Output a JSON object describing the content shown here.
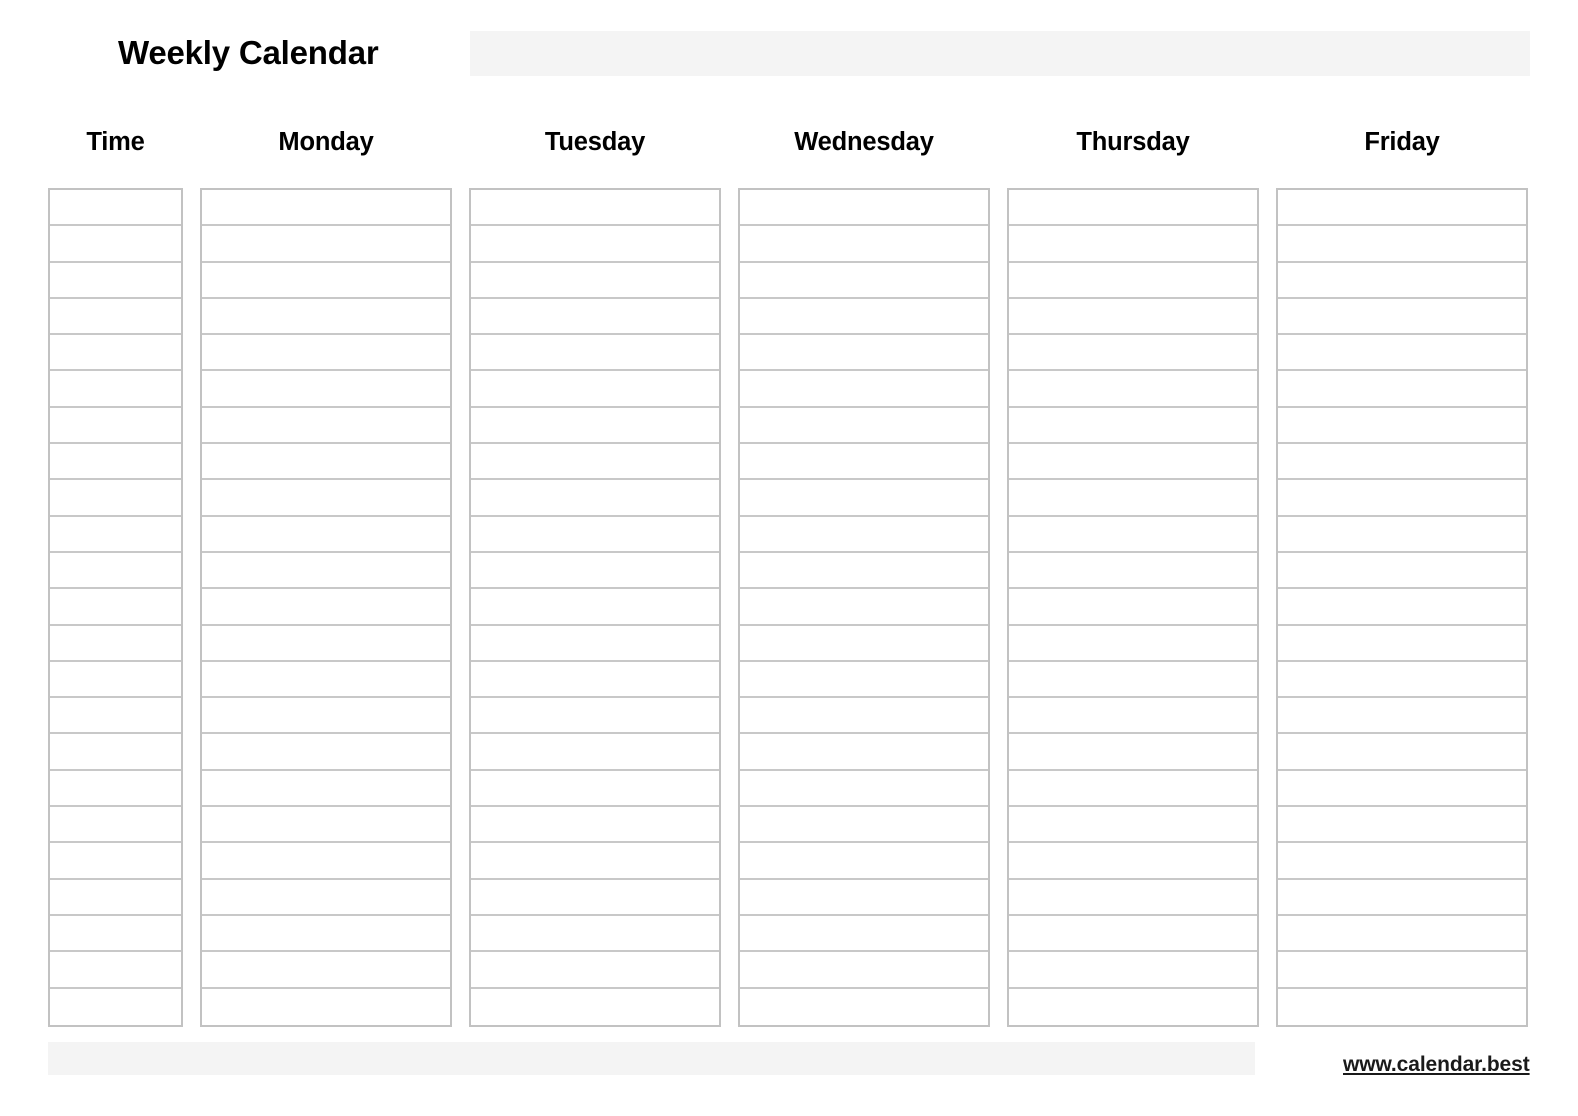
{
  "header": {
    "title": "Weekly Calendar",
    "bar_color": "#f4f4f4"
  },
  "table": {
    "columns": [
      {
        "key": "time",
        "label": "Time",
        "type": "time"
      },
      {
        "key": "monday",
        "label": "Monday",
        "type": "day"
      },
      {
        "key": "tuesday",
        "label": "Tuesday",
        "type": "day"
      },
      {
        "key": "wednesday",
        "label": "Wednesday",
        "type": "day"
      },
      {
        "key": "thursday",
        "label": "Thursday",
        "type": "day"
      },
      {
        "key": "friday",
        "label": "Friday",
        "type": "day"
      }
    ],
    "row_count": 23,
    "rows": [
      {
        "time": "",
        "monday": "",
        "tuesday": "",
        "wednesday": "",
        "thursday": "",
        "friday": ""
      },
      {
        "time": "",
        "monday": "",
        "tuesday": "",
        "wednesday": "",
        "thursday": "",
        "friday": ""
      },
      {
        "time": "",
        "monday": "",
        "tuesday": "",
        "wednesday": "",
        "thursday": "",
        "friday": ""
      },
      {
        "time": "",
        "monday": "",
        "tuesday": "",
        "wednesday": "",
        "thursday": "",
        "friday": ""
      },
      {
        "time": "",
        "monday": "",
        "tuesday": "",
        "wednesday": "",
        "thursday": "",
        "friday": ""
      },
      {
        "time": "",
        "monday": "",
        "tuesday": "",
        "wednesday": "",
        "thursday": "",
        "friday": ""
      },
      {
        "time": "",
        "monday": "",
        "tuesday": "",
        "wednesday": "",
        "thursday": "",
        "friday": ""
      },
      {
        "time": "",
        "monday": "",
        "tuesday": "",
        "wednesday": "",
        "thursday": "",
        "friday": ""
      },
      {
        "time": "",
        "monday": "",
        "tuesday": "",
        "wednesday": "",
        "thursday": "",
        "friday": ""
      },
      {
        "time": "",
        "monday": "",
        "tuesday": "",
        "wednesday": "",
        "thursday": "",
        "friday": ""
      },
      {
        "time": "",
        "monday": "",
        "tuesday": "",
        "wednesday": "",
        "thursday": "",
        "friday": ""
      },
      {
        "time": "",
        "monday": "",
        "tuesday": "",
        "wednesday": "",
        "thursday": "",
        "friday": ""
      },
      {
        "time": "",
        "monday": "",
        "tuesday": "",
        "wednesday": "",
        "thursday": "",
        "friday": ""
      },
      {
        "time": "",
        "monday": "",
        "tuesday": "",
        "wednesday": "",
        "thursday": "",
        "friday": ""
      },
      {
        "time": "",
        "monday": "",
        "tuesday": "",
        "wednesday": "",
        "thursday": "",
        "friday": ""
      },
      {
        "time": "",
        "monday": "",
        "tuesday": "",
        "wednesday": "",
        "thursday": "",
        "friday": ""
      },
      {
        "time": "",
        "monday": "",
        "tuesday": "",
        "wednesday": "",
        "thursday": "",
        "friday": ""
      },
      {
        "time": "",
        "monday": "",
        "tuesday": "",
        "wednesday": "",
        "thursday": "",
        "friday": ""
      },
      {
        "time": "",
        "monday": "",
        "tuesday": "",
        "wednesday": "",
        "thursday": "",
        "friday": ""
      },
      {
        "time": "",
        "monday": "",
        "tuesday": "",
        "wednesday": "",
        "thursday": "",
        "friday": ""
      },
      {
        "time": "",
        "monday": "",
        "tuesday": "",
        "wednesday": "",
        "thursday": "",
        "friday": ""
      },
      {
        "time": "",
        "monday": "",
        "tuesday": "",
        "wednesday": "",
        "thursday": "",
        "friday": ""
      },
      {
        "time": "",
        "monday": "",
        "tuesday": "",
        "wednesday": "",
        "thursday": "",
        "friday": ""
      }
    ],
    "border_color": "#c2c2c2",
    "rule_color": "#c8c8c8"
  },
  "footer": {
    "bar_color": "#f4f4f4",
    "link_text": "www.calendar.best"
  }
}
